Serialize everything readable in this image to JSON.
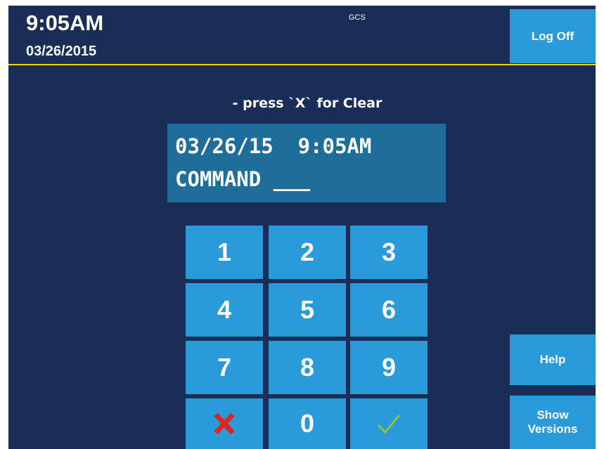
{
  "header": {
    "time": "9:05AM",
    "date": "03/26/2015",
    "center_label": "GCS",
    "logoff_label": "Log Off",
    "divider_color": "#e8d418"
  },
  "main": {
    "hint": "- press `X` for Clear",
    "display": {
      "line1": "03/26/15  9:05AM",
      "line2": "COMMAND ___"
    },
    "keypad": {
      "keys": [
        "1",
        "2",
        "3",
        "4",
        "5",
        "6",
        "7",
        "8",
        "9",
        "0"
      ],
      "clear_icon": "x-icon",
      "clear_color": "#e0241f",
      "enter_icon": "checkmark-icon",
      "enter_color": "#8cc43c"
    }
  },
  "sidebar": {
    "help_label": "Help",
    "versions_label": "Show\nVersions"
  },
  "colors": {
    "background": "#1a2d57",
    "button": "#2a9ad8",
    "display_background": "#1f6e9a"
  }
}
